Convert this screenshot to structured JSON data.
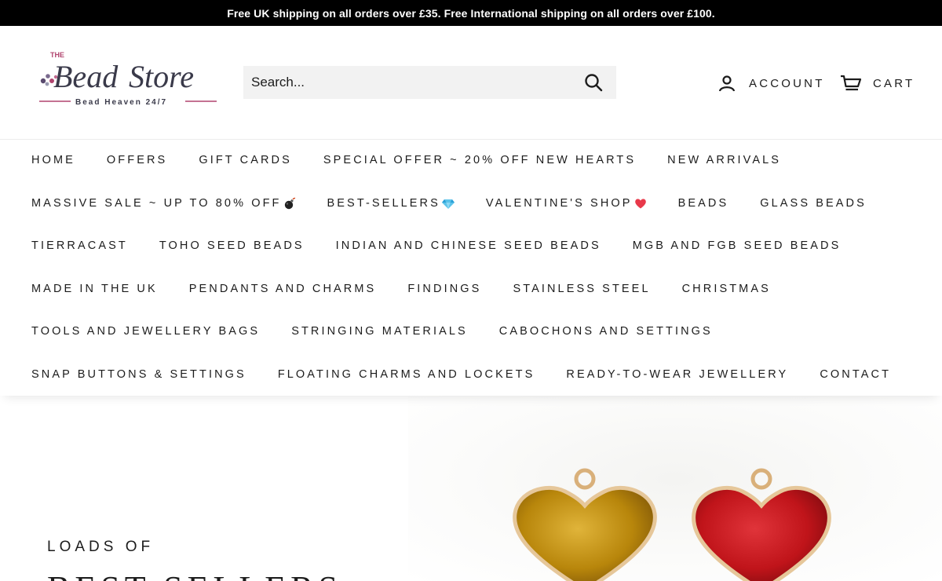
{
  "announcement": "Free UK shipping on all orders over £35. Free International shipping on all orders over £100.",
  "logo": {
    "top": "THE",
    "name": "Bead Store",
    "tagline": "Bead Heaven 24/7"
  },
  "search": {
    "placeholder": "Search...",
    "icon": "search-icon"
  },
  "header_actions": {
    "account": "ACCOUNT",
    "cart": "CART"
  },
  "nav": {
    "row1": [
      "HOME",
      "OFFERS",
      "GIFT CARDS",
      "SPECIAL OFFER ~ 20% OFF NEW HEARTS",
      "NEW ARRIVALS"
    ],
    "row2": [
      "MASSIVE SALE ~ UP TO 80% OFF",
      "BEST-SELLERS",
      "VALENTINE'S SHOP",
      "BEADS",
      "GLASS BEADS"
    ],
    "row3": [
      "TIERRACAST",
      "TOHO SEED BEADS",
      "INDIAN AND CHINESE SEED BEADS",
      "MGB AND FGB SEED BEADS"
    ],
    "row4": [
      "MADE IN THE UK",
      "PENDANTS AND CHARMS",
      "FINDINGS",
      "STAINLESS STEEL",
      "CHRISTMAS"
    ],
    "row5": [
      "TOOLS AND JEWELLERY BAGS",
      "STRINGING MATERIALS",
      "CABOCHONS AND SETTINGS"
    ],
    "row6": [
      "SNAP BUTTONS & SETTINGS",
      "FLOATING CHARMS AND LOCKETS",
      "READY-TO-WEAR JEWELLERY",
      "CONTACT"
    ]
  },
  "emoji": {
    "bomb": "bomb-icon",
    "gem": "gem-icon",
    "heart": "heart-icon"
  },
  "hero": {
    "kicker": "LOADS OF",
    "title": "BEST-SELLERS"
  },
  "colors": {
    "announcement_bg": "#000000",
    "text": "#1c1c1c",
    "search_bg": "#f2f2f2",
    "gold_heart": "#b8860b",
    "red_heart": "#c0141a"
  }
}
